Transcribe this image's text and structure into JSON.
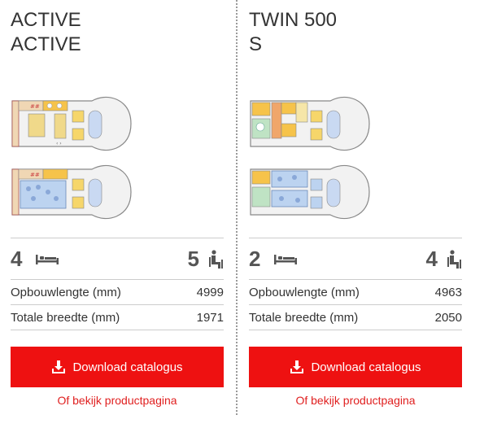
{
  "cards": [
    {
      "title_line1": "ACTIVE",
      "title_line2": "ACTIVE",
      "beds": "4",
      "seats": "5",
      "specs": [
        {
          "label": "Opbouwlengte (mm)",
          "value": "4999"
        },
        {
          "label": "Totale breedte (mm)",
          "value": "1971"
        }
      ],
      "download_label": "Download catalogus",
      "product_link": "Of bekijk productpagina"
    },
    {
      "title_line1": "TWIN 500",
      "title_line2": "S",
      "beds": "2",
      "seats": "4",
      "specs": [
        {
          "label": "Opbouwlengte (mm)",
          "value": "4963"
        },
        {
          "label": "Totale breedte (mm)",
          "value": "2050"
        }
      ],
      "download_label": "Download catalogus",
      "product_link": "Of bekijk productpagina"
    }
  ],
  "icons": {
    "bed": "bed-icon",
    "seat": "seat-icon",
    "download": "download-icon"
  },
  "colors": {
    "accent": "#ee1111",
    "link": "#e02020",
    "text": "#333333",
    "divider": "#cccccc"
  }
}
